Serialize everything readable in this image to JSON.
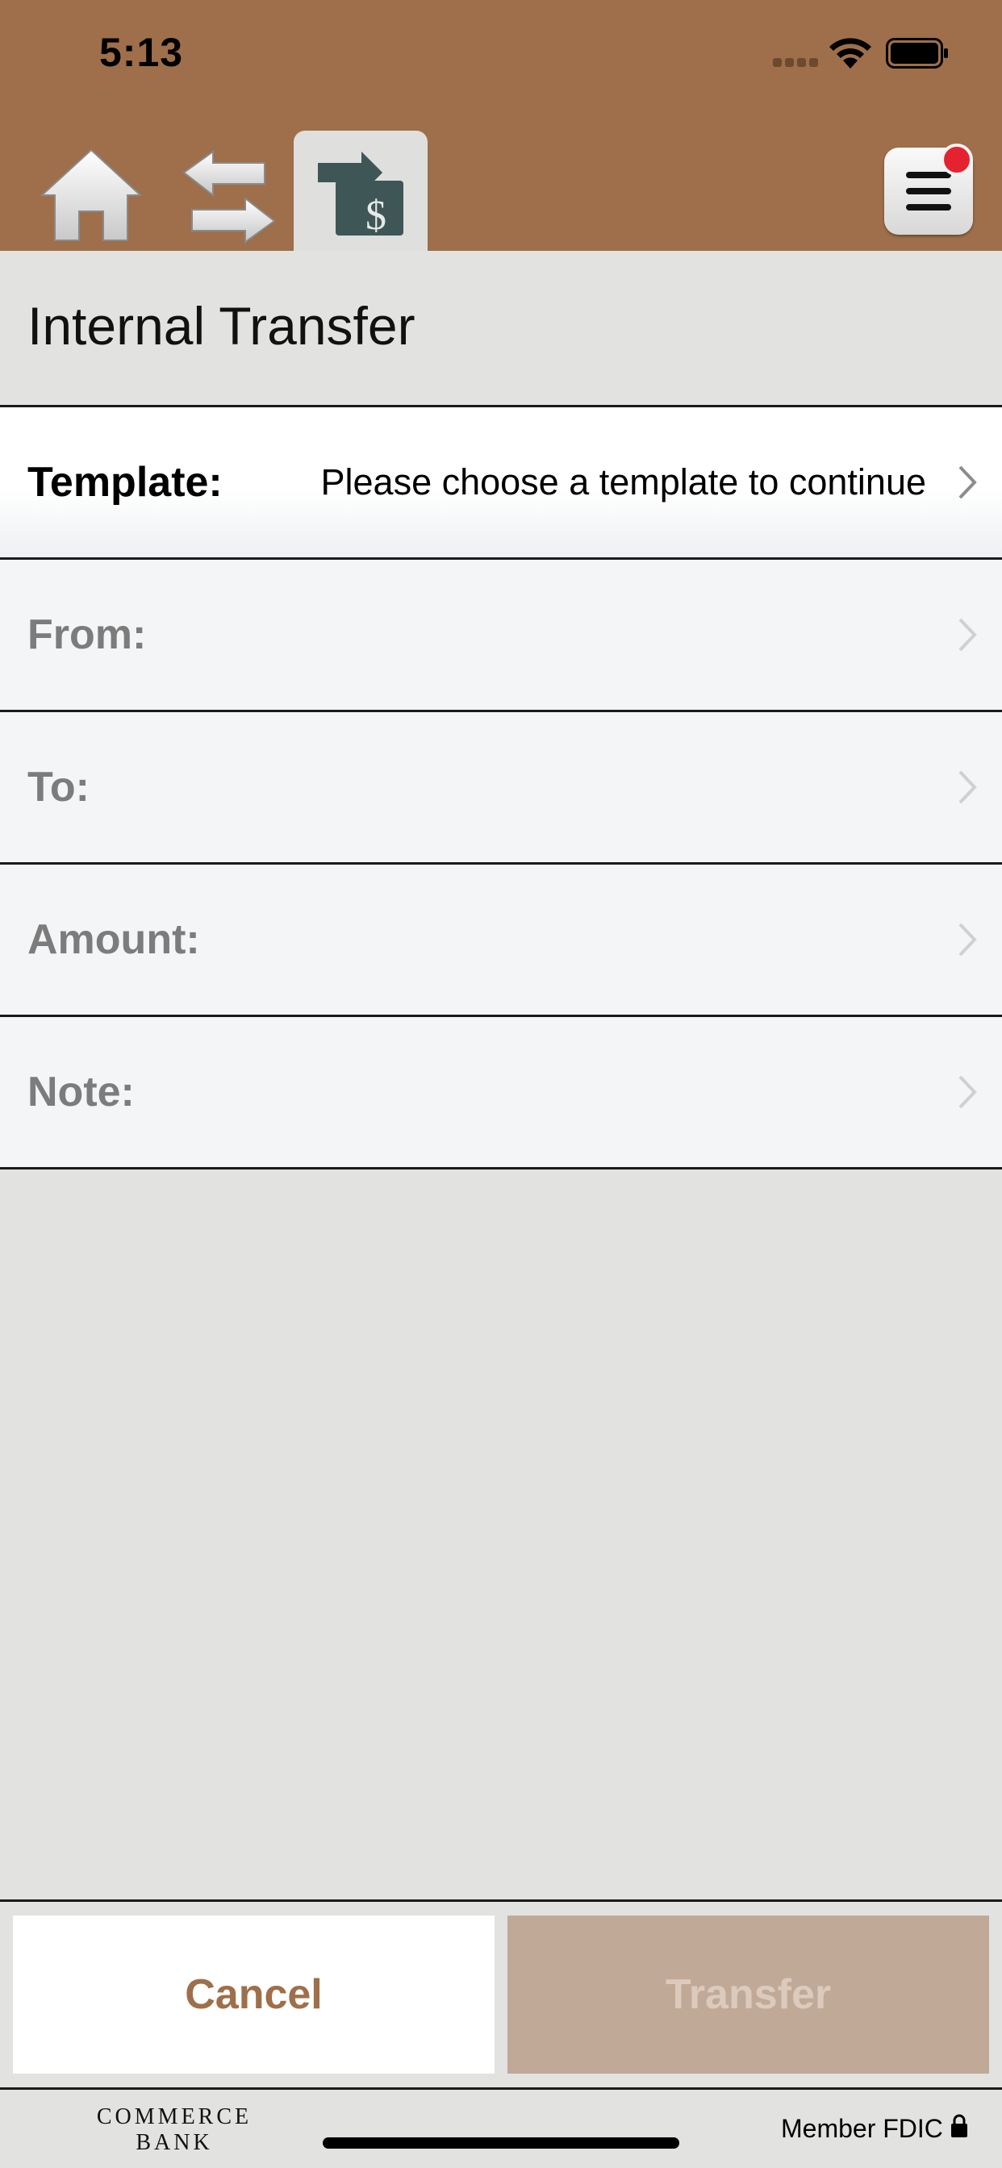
{
  "status_bar": {
    "time": "5:13"
  },
  "nav": {
    "home_icon": "home-icon",
    "swap_icon": "swap-arrows-icon",
    "transfer_icon": "transfer-dollar-icon",
    "menu_icon": "hamburger-menu-icon",
    "has_notification": true
  },
  "page": {
    "title": "Internal Transfer"
  },
  "form": {
    "rows": [
      {
        "label": "Template:",
        "value": "Please choose a template to continue",
        "enabled": true
      },
      {
        "label": "From:",
        "value": "",
        "enabled": false
      },
      {
        "label": "To:",
        "value": "",
        "enabled": false
      },
      {
        "label": "Amount:",
        "value": "",
        "enabled": false
      },
      {
        "label": "Note:",
        "value": "",
        "enabled": false
      }
    ]
  },
  "actions": {
    "cancel_label": "Cancel",
    "transfer_label": "Transfer",
    "transfer_enabled": false
  },
  "footer": {
    "logo_line1": "COMMERCE",
    "logo_line2": "BANK",
    "fdic": "Member FDIC"
  },
  "colors": {
    "header_brown": "#9e6f4a",
    "accent": "#9e6f4a",
    "disabled_button": "#c1a998",
    "notification": "#e52330"
  }
}
